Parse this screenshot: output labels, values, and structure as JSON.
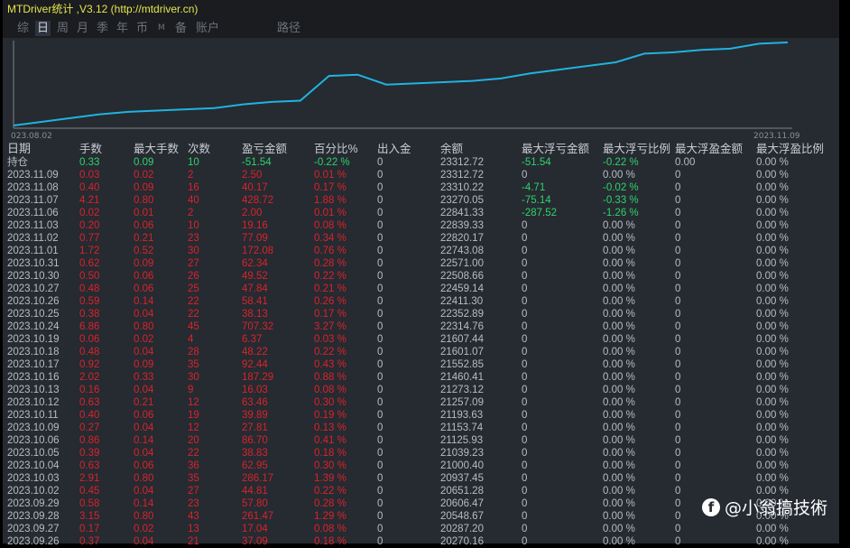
{
  "title": "MTDriver统计 ,V3.12 (http://mtdriver.cn)",
  "tabs": [
    {
      "label": "综"
    },
    {
      "label": "日",
      "active": true
    },
    {
      "label": "周"
    },
    {
      "label": "月"
    },
    {
      "label": "季"
    },
    {
      "label": "年"
    },
    {
      "label": "币"
    },
    {
      "label": "M"
    },
    {
      "label": "备"
    },
    {
      "label": "账户"
    },
    {
      "label": "路径"
    }
  ],
  "chart_data": {
    "type": "line",
    "x_start_label": "023.08.02",
    "x_end_label": "2023.11.09",
    "color": "#1fb3e0",
    "values": [
      0,
      3,
      6,
      9,
      11,
      12,
      13,
      14,
      17,
      19,
      20,
      40,
      41,
      33,
      34,
      35,
      36,
      38,
      42,
      45,
      48,
      51,
      58,
      59,
      61,
      62,
      66,
      67
    ]
  },
  "headers": [
    "日期",
    "手数",
    "最大手数",
    "次数",
    "盈亏金额",
    "百分比%",
    "出入金",
    "余额",
    "最大浮亏金额",
    "最大浮亏比例",
    "最大浮盈金额",
    "最大浮盈比例"
  ],
  "position_row": [
    "持仓",
    "0.33",
    "0.09",
    "10",
    "-51.54",
    "-0.22 %",
    "0",
    "23312.72",
    "-51.54",
    "-0.22 %",
    "0.00",
    "0.00 %"
  ],
  "rows": [
    [
      "2023.11.09",
      "0.03",
      "0.02",
      "2",
      "2.50",
      "0.01 %",
      "0",
      "23312.72",
      "0",
      "0.00 %",
      "0",
      "0.00 %"
    ],
    [
      "2023.11.08",
      "0.40",
      "0.09",
      "16",
      "40.17",
      "0.17 %",
      "0",
      "23310.22",
      "-4.71",
      "-0.02 %",
      "0",
      "0.00 %"
    ],
    [
      "2023.11.07",
      "4.21",
      "0.80",
      "40",
      "428.72",
      "1.88 %",
      "0",
      "23270.05",
      "-75.14",
      "-0.33 %",
      "0",
      "0.00 %"
    ],
    [
      "2023.11.06",
      "0.02",
      "0.01",
      "2",
      "2.00",
      "0.01 %",
      "0",
      "22841.33",
      "-287.52",
      "-1.26 %",
      "0",
      "0.00 %"
    ],
    [
      "2023.11.03",
      "0.20",
      "0.06",
      "10",
      "19.16",
      "0.08 %",
      "0",
      "22839.33",
      "0",
      "0.00 %",
      "0",
      "0.00 %"
    ],
    [
      "2023.11.02",
      "0.77",
      "0.21",
      "23",
      "77.09",
      "0.34 %",
      "0",
      "22820.17",
      "0",
      "0.00 %",
      "0",
      "0.00 %"
    ],
    [
      "2023.11.01",
      "1.72",
      "0.52",
      "30",
      "172.08",
      "0.76 %",
      "0",
      "22743.08",
      "0",
      "0.00 %",
      "0",
      "0.00 %"
    ],
    [
      "2023.10.31",
      "0.62",
      "0.09",
      "27",
      "62.34",
      "0.28 %",
      "0",
      "22571.00",
      "0",
      "0.00 %",
      "0",
      "0.00 %"
    ],
    [
      "2023.10.30",
      "0.50",
      "0.06",
      "26",
      "49.52",
      "0.22 %",
      "0",
      "22508.66",
      "0",
      "0.00 %",
      "0",
      "0.00 %"
    ],
    [
      "2023.10.27",
      "0.48",
      "0.06",
      "25",
      "47.84",
      "0.21 %",
      "0",
      "22459.14",
      "0",
      "0.00 %",
      "0",
      "0.00 %"
    ],
    [
      "2023.10.26",
      "0.59",
      "0.14",
      "22",
      "58.41",
      "0.26 %",
      "0",
      "22411.30",
      "0",
      "0.00 %",
      "0",
      "0.00 %"
    ],
    [
      "2023.10.25",
      "0.38",
      "0.04",
      "22",
      "38.13",
      "0.17 %",
      "0",
      "22352.89",
      "0",
      "0.00 %",
      "0",
      "0.00 %"
    ],
    [
      "2023.10.24",
      "6.86",
      "0.80",
      "45",
      "707.32",
      "3.27 %",
      "0",
      "22314.76",
      "0",
      "0.00 %",
      "0",
      "0.00 %"
    ],
    [
      "2023.10.19",
      "0.06",
      "0.02",
      "4",
      "6.37",
      "0.03 %",
      "0",
      "21607.44",
      "0",
      "0.00 %",
      "0",
      "0.00 %"
    ],
    [
      "2023.10.18",
      "0.48",
      "0.04",
      "28",
      "48.22",
      "0.22 %",
      "0",
      "21601.07",
      "0",
      "0.00 %",
      "0",
      "0.00 %"
    ],
    [
      "2023.10.17",
      "0.92",
      "0.09",
      "35",
      "92.44",
      "0.43 %",
      "0",
      "21552.85",
      "0",
      "0.00 %",
      "0",
      "0.00 %"
    ],
    [
      "2023.10.16",
      "2.02",
      "0.33",
      "30",
      "187.29",
      "0.88 %",
      "0",
      "21460.41",
      "0",
      "0.00 %",
      "0",
      "0.00 %"
    ],
    [
      "2023.10.13",
      "0.16",
      "0.04",
      "9",
      "16.03",
      "0.08 %",
      "0",
      "21273.12",
      "0",
      "0.00 %",
      "0",
      "0.00 %"
    ],
    [
      "2023.10.12",
      "0.63",
      "0.21",
      "12",
      "63.46",
      "0.30 %",
      "0",
      "21257.09",
      "0",
      "0.00 %",
      "0",
      "0.00 %"
    ],
    [
      "2023.10.11",
      "0.40",
      "0.06",
      "19",
      "39.89",
      "0.19 %",
      "0",
      "21193.63",
      "0",
      "0.00 %",
      "0",
      "0.00 %"
    ],
    [
      "2023.10.09",
      "0.27",
      "0.04",
      "12",
      "27.81",
      "0.13 %",
      "0",
      "21153.74",
      "0",
      "0.00 %",
      "0",
      "0.00 %"
    ],
    [
      "2023.10.06",
      "0.86",
      "0.14",
      "20",
      "86.70",
      "0.41 %",
      "0",
      "21125.93",
      "0",
      "0.00 %",
      "0",
      "0.00 %"
    ],
    [
      "2023.10.05",
      "0.39",
      "0.04",
      "22",
      "38.83",
      "0.18 %",
      "0",
      "21039.23",
      "0",
      "0.00 %",
      "0",
      "0.00 %"
    ],
    [
      "2023.10.04",
      "0.63",
      "0.06",
      "36",
      "62.95",
      "0.30 %",
      "0",
      "21000.40",
      "0",
      "0.00 %",
      "0",
      "0.00 %"
    ],
    [
      "2023.10.03",
      "2.91",
      "0.80",
      "35",
      "286.17",
      "1.39 %",
      "0",
      "20937.45",
      "0",
      "0.00 %",
      "0",
      "0.00 %"
    ],
    [
      "2023.10.02",
      "0.45",
      "0.04",
      "27",
      "44.81",
      "0.22 %",
      "0",
      "20651.28",
      "0",
      "0.00 %",
      "0",
      "0.00 %"
    ],
    [
      "2023.09.29",
      "0.58",
      "0.14",
      "23",
      "57.80",
      "0.28 %",
      "0",
      "20606.47",
      "0",
      "0.00 %",
      "0",
      "0.00 %"
    ],
    [
      "2023.09.28",
      "3.15",
      "0.80",
      "43",
      "261.47",
      "1.29 %",
      "0",
      "20548.67",
      "0",
      "0.00 %",
      "0",
      "0.00 %"
    ],
    [
      "2023.09.27",
      "0.17",
      "0.02",
      "13",
      "17.04",
      "0.08 %",
      "0",
      "20287.20",
      "0",
      "0.00 %",
      "0",
      "0.00 %"
    ],
    [
      "2023.09.26",
      "0.37",
      "0.04",
      "21",
      "37.09",
      "0.18 %",
      "0",
      "20270.16",
      "0",
      "0.00 %",
      "0",
      "0.00 %"
    ]
  ],
  "watermark": "@小翁搞技術"
}
